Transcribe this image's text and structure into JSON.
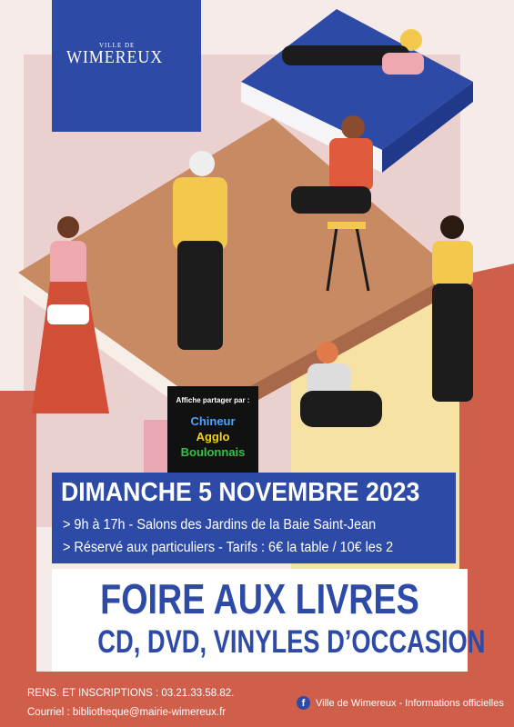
{
  "logo": {
    "ville": "VILLE DE",
    "name": "WIMEREUX"
  },
  "affiche": {
    "label": "Affiche partager par :",
    "line1": "Chineur",
    "line2": "Agglo",
    "line3": "Boulonnais"
  },
  "event": {
    "date": "DIMANCHE 5 NOVEMBRE 2023",
    "line1": "> 9h à 17h - Salons des Jardins de la Baie Saint-Jean",
    "line2": "> Réservé aux particuliers - Tarifs : 6€ la table / 10€ les 2"
  },
  "title": {
    "line1": "FOIRE AUX LIVRES",
    "line2": "CD, DVD, VINYLES D’OCCASION"
  },
  "footer": {
    "rens": "RENS. ET INSCRIPTIONS : 03.21.33.58.82.",
    "mail": "Courriel : bibliotheque@mairie-wimereux.fr",
    "facebook": "Ville de Wimereux - Informations officielles",
    "fb_icon": "f"
  },
  "colors": {
    "blue": "#2d4aa6",
    "red": "#cf5f4b",
    "tan": "#c78a63",
    "yellow": "#f6e3a3",
    "pink": "#e9c9c7"
  }
}
